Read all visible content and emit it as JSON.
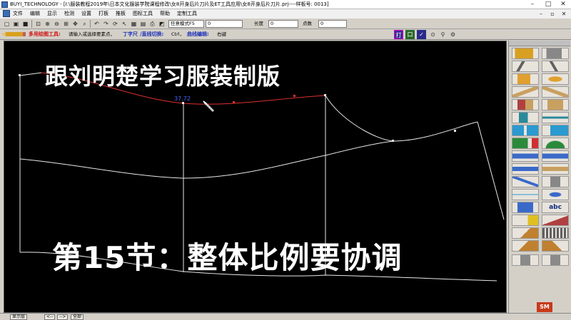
{
  "window": {
    "title": "BUYI_TECHNOLOGY - [I:\\服装教程2019年\\日本文化服装学院课程修改\\女8开身后片刀片及ET工具应用\\女8开身后片刀片.prj----样板号: 0013]",
    "controls": [
      "–",
      "□",
      "✕"
    ]
  },
  "menu": {
    "items": [
      "文件",
      "编辑",
      "显示",
      "检测",
      "设置",
      "打板",
      "推板",
      "图标工具",
      "帮助",
      "定制工具"
    ],
    "right_controls": [
      "–",
      "▫",
      "✕"
    ]
  },
  "toolbar": {
    "mode_value": "任意模式F5",
    "mode_number": "0",
    "length_label": "长度",
    "length_value": "0",
    "points_label": "点数",
    "points_value": "0",
    "right_icons": [
      "打",
      "口",
      "✓"
    ]
  },
  "status": {
    "tool_name": "多用绘图工具:",
    "hint": "请输入或选择要素点，",
    "tshape_label": "丁字尺",
    "tshape_toggle": "/直线切换:",
    "key1": "Ctrl，",
    "curve_edit_label": "曲线编辑:",
    "key2": "右键"
  },
  "canvas": {
    "overlay_title": "跟刘明楚学习服装制版",
    "overlay_subtitle": "第15节：整体比例要协调",
    "measure_label": "37.72",
    "colors": {
      "background": "#000000",
      "pattern_line": "#e8e8e8",
      "highlight_line": "#e03030",
      "measure_text": "#4466ff"
    }
  },
  "panel": {
    "text_tool": "abc"
  },
  "bottom": {
    "show_layer": "显示层",
    "prev": "<--",
    "next": "-->",
    "all": "全部"
  }
}
